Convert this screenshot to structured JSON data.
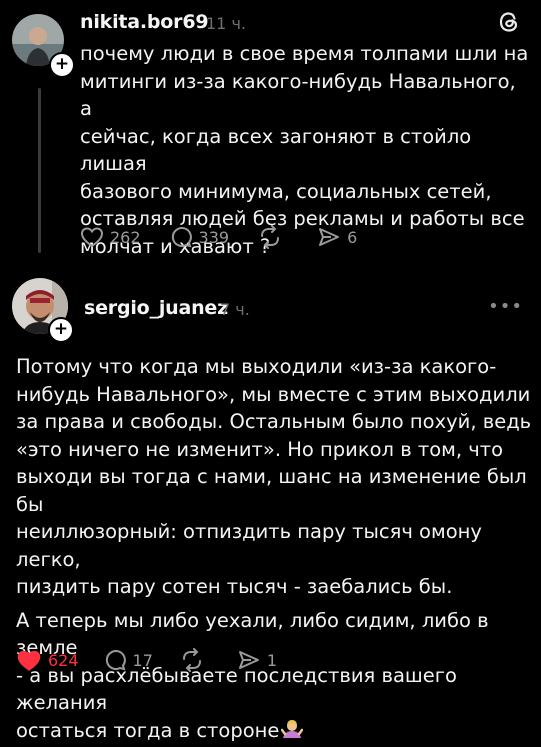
{
  "post1": {
    "username": "nikita.bor69",
    "time": "11 ч.",
    "text": "почему люди в свое время толпами шли на митинги из-за какого-нибудь Навального, а сейчас, когда всех загоняют в стойло лишая базового минимума, социальных сетей, оставляя людей без рекламы и работы все молчат и хавают ?",
    "lines": [
      "почему люди в свое время толпами шли на",
      "митинги из-за какого-нибудь Навального, а",
      "сейчас, когда всех загоняют в стойло лишая",
      "базового минимума, социальных сетей,",
      "оставляя людей без рекламы и работы все",
      "молчат и хавают ?"
    ],
    "likes": "262",
    "replies": "339",
    "shares": "6"
  },
  "post2": {
    "username": "sergio_juanez",
    "time": "7 ч.",
    "para1_lines": [
      "Потому что когда мы выходили «из-за какого-",
      "нибудь Навального», мы вместе с этим выходили",
      "за права и свободы. Остальным было похуй, ведь",
      "«это ничего не изменит». Но прикол в том, что",
      "выходи вы тогда с нами, шанс на изменение был бы",
      "неиллюзорный: отпиздить пару тысяч омону легко,",
      "пиздить пару сотен тысяч - заебались бы."
    ],
    "para2_lines": [
      "А теперь мы либо уехали, либо сидим, либо в земле",
      "- а вы расхлёбываете последствия вашего желания",
      "остаться тогда в стороне"
    ],
    "likes": "624",
    "replies": "17",
    "shares": "1",
    "liked": true
  },
  "icons": {
    "threads": "threads-logo-icon",
    "like": "heart-icon",
    "reply": "comment-bubble-icon",
    "repost": "repost-icon",
    "share": "send-icon",
    "more": "more-dots-icon"
  },
  "colors": {
    "background": "#000000",
    "text": "#f3f3f3",
    "muted": "#9a9a9a",
    "like_active": "#ff3040"
  }
}
